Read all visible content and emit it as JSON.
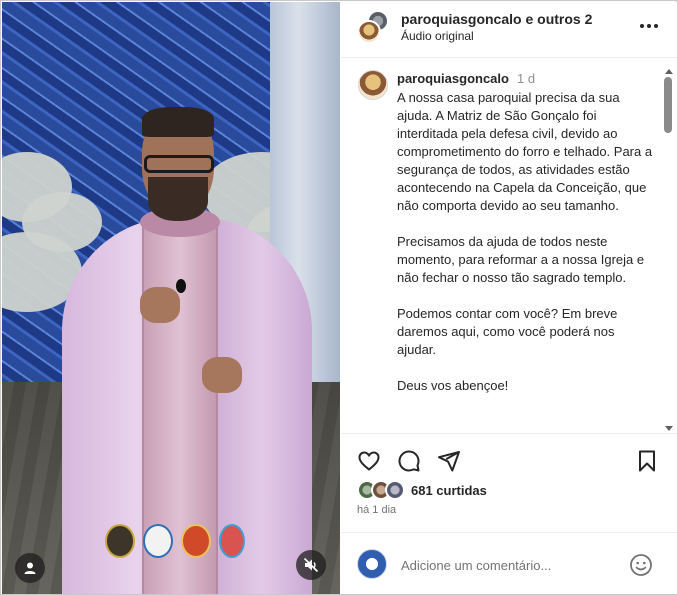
{
  "media": {
    "controls": {
      "profile_icon": "user-icon",
      "mute_icon": "speaker-muted-icon"
    },
    "logos": [
      "parish-logo",
      "chapel-logo",
      "crown-logo",
      "heart-logo"
    ]
  },
  "header": {
    "title": "paroquiasgoncalo e outros 2",
    "subtitle": "Áudio original",
    "more_icon": "more-horizontal-icon"
  },
  "caption": {
    "username": "paroquiasgoncalo",
    "time": "1 d",
    "paragraphs": [
      "A nossa casa paroquial precisa da sua ajuda. A Matriz de São Gonçalo foi interditada pela defesa civil, devido ao comprometimento do forro e telhado. Para a segurança de todos, as atividades estão acontecendo na Capela da Conceição, que não comporta devido ao seu tamanho.",
      "Precisamos da ajuda de todos neste momento, para reformar a a nossa Igreja e não fechar o nosso tão sagrado templo.",
      "Podemos contar com você? Em breve daremos aqui, como você poderá nos ajudar.",
      "Deus vos abençoe!"
    ]
  },
  "actions": {
    "like_icon": "heart-icon",
    "comment_icon": "comment-icon",
    "share_icon": "send-icon",
    "save_icon": "bookmark-icon"
  },
  "likes": {
    "text": "681 curtidas"
  },
  "post_age": "há 1 dia",
  "comment": {
    "placeholder": "Adicione um comentário...",
    "emoji_icon": "emoji-icon"
  },
  "colors": {
    "text": "#262626",
    "muted": "#737373",
    "divider": "#efefef"
  }
}
